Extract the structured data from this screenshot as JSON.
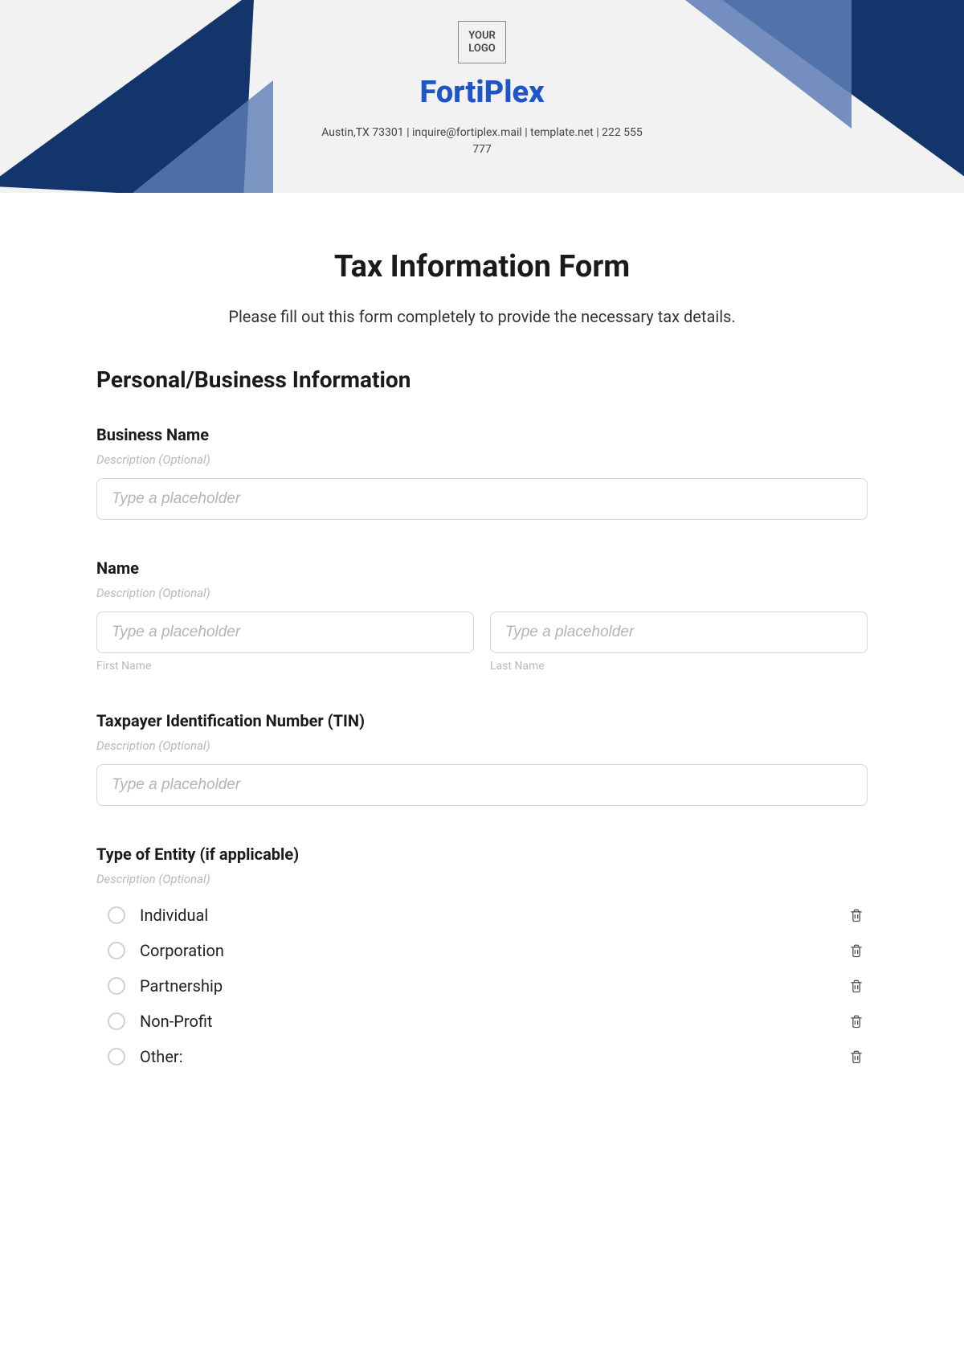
{
  "header": {
    "logo_text": "YOUR\nLOGO",
    "brand": "FortiPlex",
    "contact": "Austin,TX 73301 | inquire@fortiplex.mail | template.net | 222 555 777"
  },
  "form": {
    "title": "Tax Information Form",
    "subtitle": "Please fill out this form completely to provide the necessary tax details.",
    "section1_heading": "Personal/Business Information",
    "business_name": {
      "label": "Business Name",
      "desc": "Description (Optional)",
      "placeholder": "Type a placeholder"
    },
    "name": {
      "label": "Name",
      "desc": "Description (Optional)",
      "first_placeholder": "Type a placeholder",
      "first_sublabel": "First Name",
      "last_placeholder": "Type a placeholder",
      "last_sublabel": "Last Name"
    },
    "tin": {
      "label": "Taxpayer Identification Number (TIN)",
      "desc": "Description (Optional)",
      "placeholder": "Type a placeholder"
    },
    "entity": {
      "label": "Type of Entity (if applicable)",
      "desc": "Description (Optional)",
      "options": [
        "Individual",
        "Corporation",
        "Partnership",
        "Non-Profit",
        "Other:"
      ]
    }
  }
}
